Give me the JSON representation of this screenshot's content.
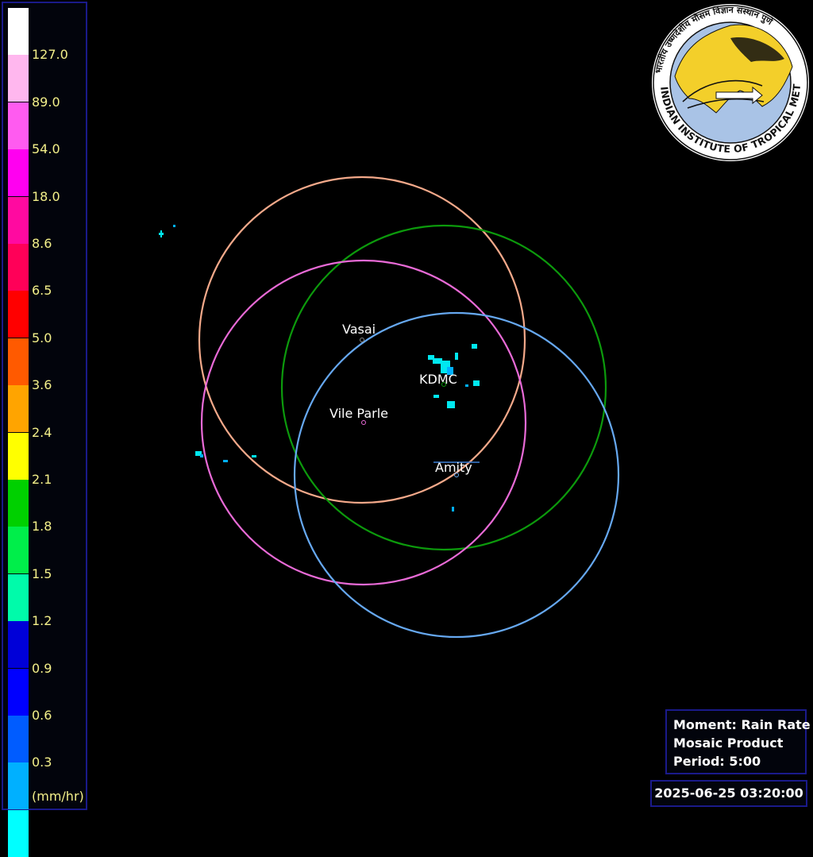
{
  "legend": {
    "unit": "(mm/hr)",
    "levels": [
      {
        "label": "",
        "color": "#ffffff"
      },
      {
        "label": "127.0",
        "color": "#ffb7ee"
      },
      {
        "label": "89.0",
        "color": "#ff5bf0"
      },
      {
        "label": "54.0",
        "color": "#ff00f0"
      },
      {
        "label": "18.0",
        "color": "#ff0aa0"
      },
      {
        "label": "8.6",
        "color": "#ff0058"
      },
      {
        "label": "6.5",
        "color": "#ff0000"
      },
      {
        "label": "5.0",
        "color": "#ff5a00"
      },
      {
        "label": "3.6",
        "color": "#ffa400"
      },
      {
        "label": "2.4",
        "color": "#ffff00"
      },
      {
        "label": "2.1",
        "color": "#00d000"
      },
      {
        "label": "1.8",
        "color": "#00ee4a"
      },
      {
        "label": "1.5",
        "color": "#00fbaa"
      },
      {
        "label": "1.2",
        "color": "#0000d8"
      },
      {
        "label": "0.9",
        "color": "#0000ff"
      },
      {
        "label": "0.6",
        "color": "#005cff"
      },
      {
        "label": "0.3",
        "color": "#00b0ff"
      },
      {
        "label": "",
        "color": "#00ffff"
      }
    ]
  },
  "radars": [
    {
      "name": "Vasai",
      "color": "#f4a98a"
    },
    {
      "name": "KDMC",
      "color": "#0c9a0c"
    },
    {
      "name": "Vile Parle",
      "color": "#e86ad6"
    },
    {
      "name": "Amity",
      "color": "#66a8f0"
    }
  ],
  "info": {
    "moment": "Moment: Rain Rate",
    "product": "Mosaic Product",
    "period": "Period: 5:00"
  },
  "timestamp": "2025-06-25 03:20:00",
  "logo": {
    "text": "INDIAN INSTITUTE OF TROPICAL METEOROLOGY PUNE",
    "hindi": "भारतीय उष्णदेशीय मौसम विज्ञान संस्थान पुणे"
  }
}
